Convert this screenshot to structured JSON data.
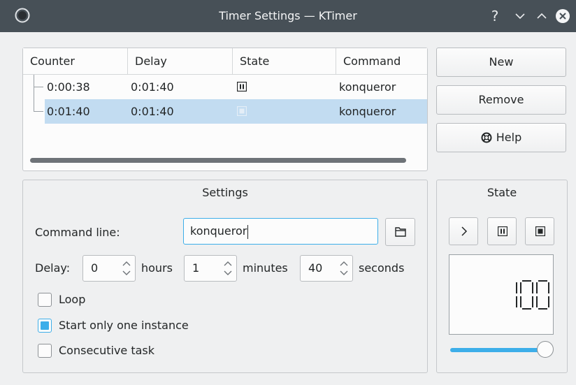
{
  "window": {
    "title": "Timer Settings — KTimer",
    "help_glyph": "?",
    "icons": [
      "ktimer-app-icon",
      "help-icon",
      "minimize-icon",
      "maximize-icon",
      "close-icon"
    ]
  },
  "table": {
    "columns": [
      "Counter",
      "Delay",
      "State",
      "Command"
    ],
    "rows": [
      {
        "counter": "0:00:38",
        "delay": "0:01:40",
        "state": "paused",
        "command": "konqueror",
        "selected": false
      },
      {
        "counter": "0:01:40",
        "delay": "0:01:40",
        "state": "stopped",
        "command": "konqueror",
        "selected": true
      }
    ]
  },
  "buttons": {
    "new": "New",
    "remove": "Remove",
    "help": "Help"
  },
  "settings": {
    "title": "Settings",
    "command_label": "Command line:",
    "command_value": "konqueror",
    "delay_label": "Delay:",
    "hours_value": "0",
    "hours_unit": "hours",
    "minutes_value": "1",
    "minutes_unit": "minutes",
    "seconds_value": "40",
    "seconds_unit": "seconds",
    "loop_label": "Loop",
    "loop_checked": false,
    "one_instance_label": "Start only one instance",
    "one_instance_checked": true,
    "consecutive_label": "Consecutive task",
    "consecutive_checked": false
  },
  "state": {
    "title": "State",
    "lcd_value": "100",
    "slider_fraction": 1.0
  },
  "colors": {
    "accent": "#3daee9",
    "selection": "#c2dcf1",
    "titlebar": "#475057"
  }
}
